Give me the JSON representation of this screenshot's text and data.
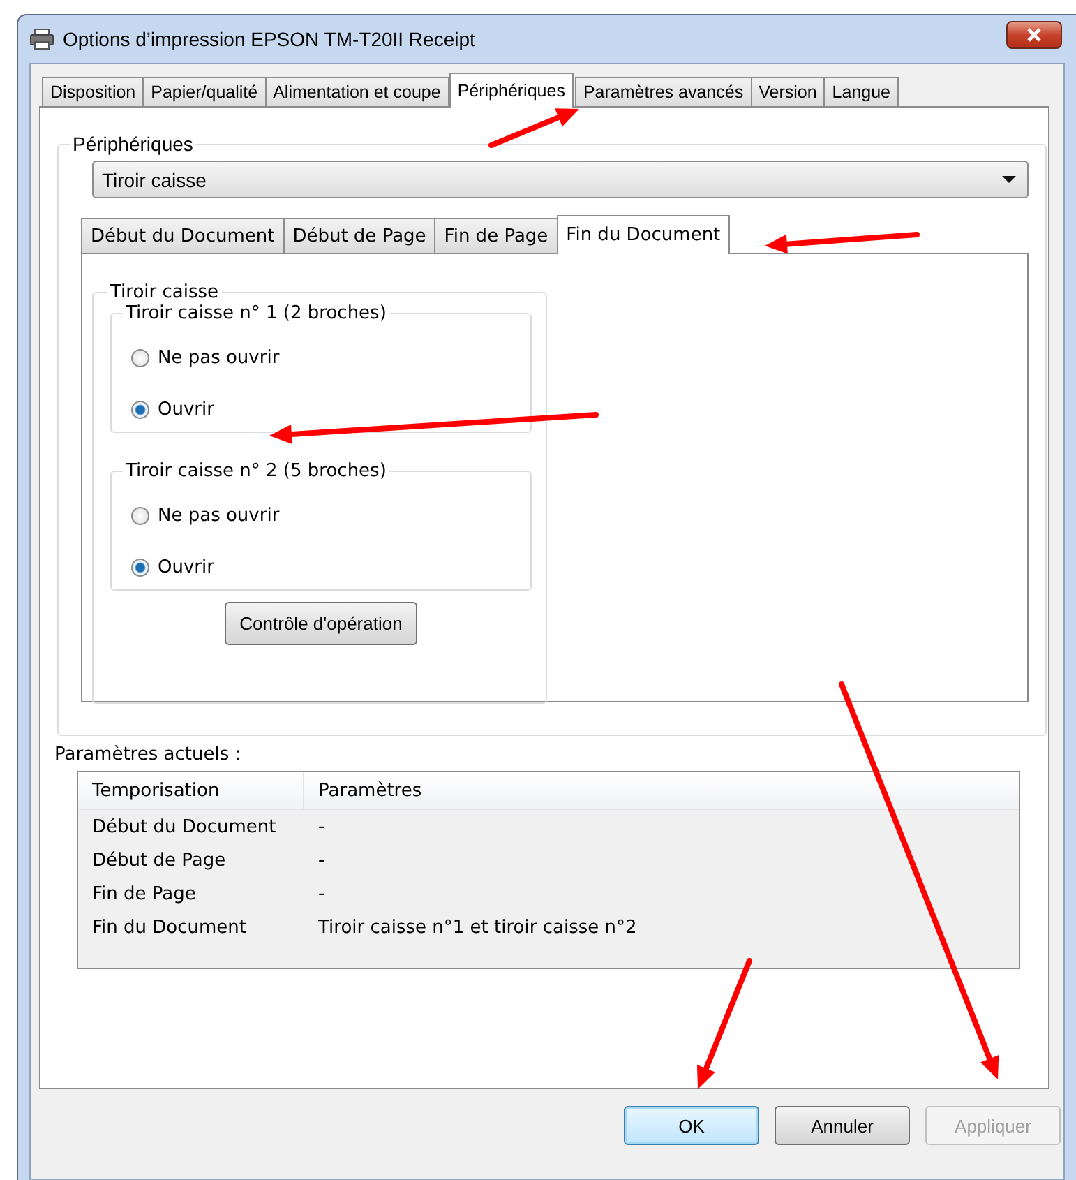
{
  "window": {
    "title": "Options d’impression EPSON TM-T20II Receipt"
  },
  "tabs": [
    {
      "label": "Disposition",
      "selected": false
    },
    {
      "label": "Papier/qualité",
      "selected": false
    },
    {
      "label": "Alimentation et coupe",
      "selected": false
    },
    {
      "label": "Périphériques",
      "selected": true
    },
    {
      "label": "Paramètres avancés",
      "selected": false
    },
    {
      "label": "Version",
      "selected": false
    },
    {
      "label": "Langue",
      "selected": false
    }
  ],
  "peripherals": {
    "label": "Périphériques",
    "dropdown": {
      "value": "Tiroir caisse"
    },
    "subtabs": [
      {
        "label": "Début du Document",
        "selected": false
      },
      {
        "label": "Début de Page",
        "selected": false
      },
      {
        "label": "Fin de Page",
        "selected": false
      },
      {
        "label": "Fin du Document",
        "selected": true
      }
    ],
    "drawer_group": {
      "label": "Tiroir caisse",
      "drawers": [
        {
          "label": "Tiroir caisse n° 1 (2 broches)",
          "options": [
            {
              "label": "Ne pas ouvrir",
              "selected": false
            },
            {
              "label": "Ouvrir",
              "selected": true
            }
          ]
        },
        {
          "label": "Tiroir caisse n° 2 (5 broches)",
          "options": [
            {
              "label": "Ne pas ouvrir",
              "selected": false
            },
            {
              "label": "Ouvrir",
              "selected": true
            }
          ]
        }
      ],
      "test_button": "Contrôle d'opération"
    }
  },
  "current_settings": {
    "label": "Paramètres actuels :",
    "columns": [
      "Temporisation",
      "Paramètres"
    ],
    "rows": [
      [
        "Début du Document",
        "-"
      ],
      [
        "Début de Page",
        "-"
      ],
      [
        "Fin de Page",
        "-"
      ],
      [
        "Fin du Document",
        "Tiroir caisse n°1 et tiroir caisse n°2"
      ]
    ]
  },
  "buttons": [
    {
      "label": "OK",
      "kind": "default",
      "disabled": false
    },
    {
      "label": "Annuler",
      "kind": "normal",
      "disabled": false
    },
    {
      "label": "Appliquer",
      "kind": "normal",
      "disabled": true
    }
  ]
}
